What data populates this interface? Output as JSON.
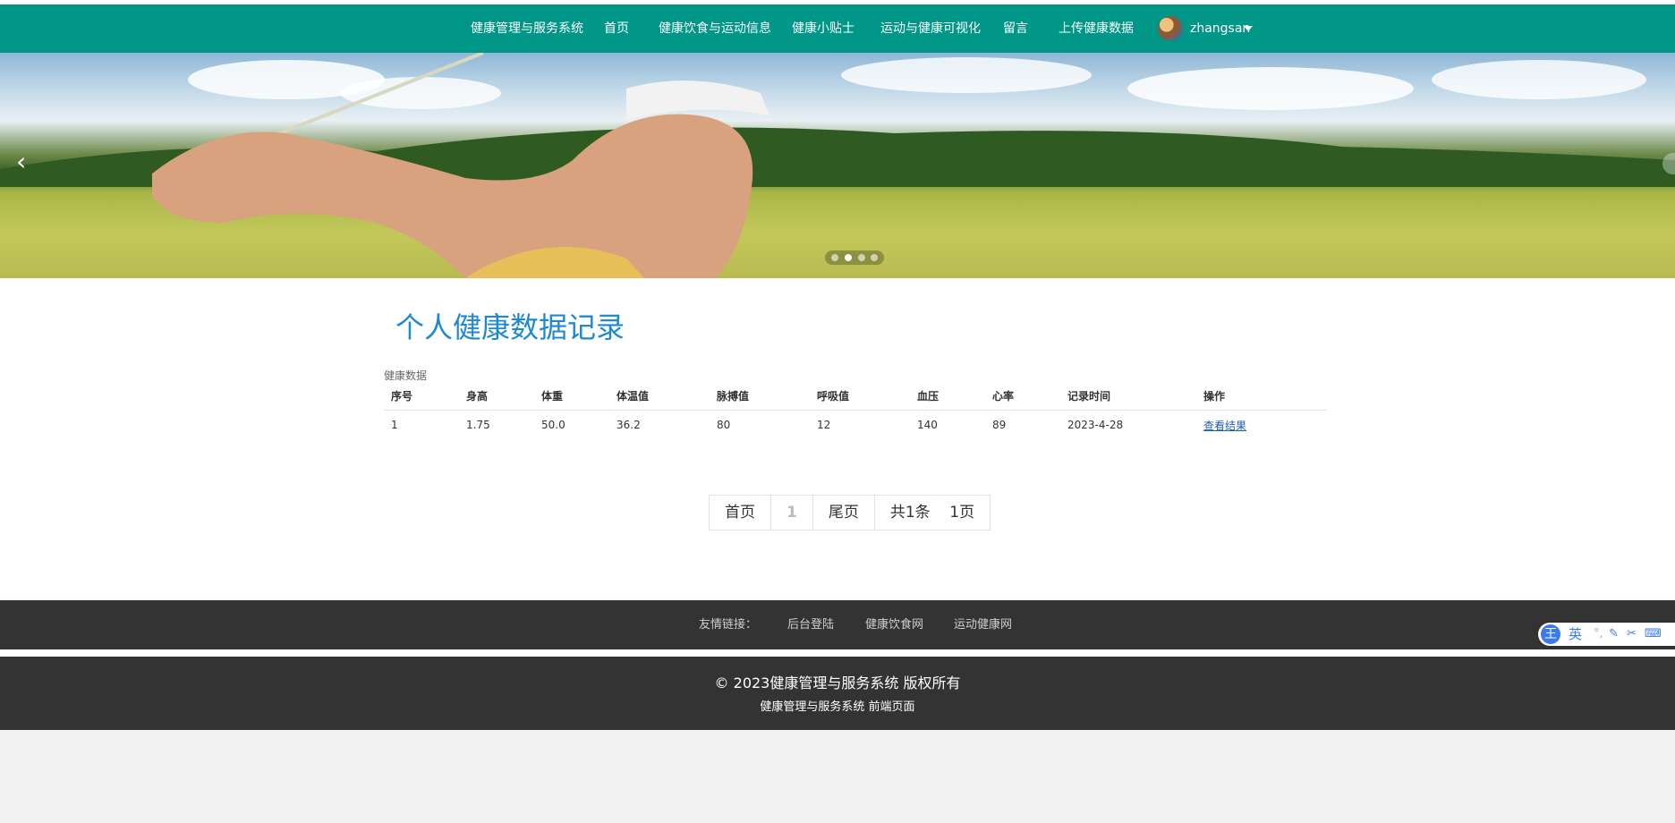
{
  "nav": {
    "brand": "健康管理与服务系统",
    "items": [
      "首页",
      "健康饮食与运动信息",
      "健康小贴士",
      "运动与健康可视化",
      "留言",
      "上传健康数据"
    ],
    "username": "zhangsan"
  },
  "banner": {
    "prev_icon": "‹",
    "active_slide": 2,
    "slide_count": 4
  },
  "main": {
    "title": "个人健康数据记录",
    "section_label": "健康数据",
    "table": {
      "headers": [
        "序号",
        "身高",
        "体重",
        "体温值",
        "脉搏值",
        "呼吸值",
        "血压",
        "心率",
        "记录时间",
        "操作"
      ],
      "rows": [
        [
          "1",
          "1.75",
          "50.0",
          "36.2",
          "80",
          "12",
          "140",
          "89",
          "2023-4-28",
          "查看结果"
        ]
      ]
    },
    "pager": {
      "first": "首页",
      "current": "1",
      "last": "尾页",
      "total": "共1条",
      "pages": "1页"
    }
  },
  "footer": {
    "links_label": "友情链接：",
    "links": [
      "后台登陆",
      "健康饮食网",
      "运动健康网"
    ],
    "copyright": "© 2023健康管理与服务系统 版权所有",
    "subtitle": "健康管理与服务系统 前端页面"
  },
  "ime": {
    "logo": "王",
    "mode": "英",
    "icons": [
      "pen-icon",
      "scissors-icon",
      "keyboard-icon"
    ]
  },
  "colors": {
    "nav_bg": "#009688",
    "title": "#1e88d0",
    "footer_bg": "#333333",
    "link": "#1e5ea8"
  }
}
